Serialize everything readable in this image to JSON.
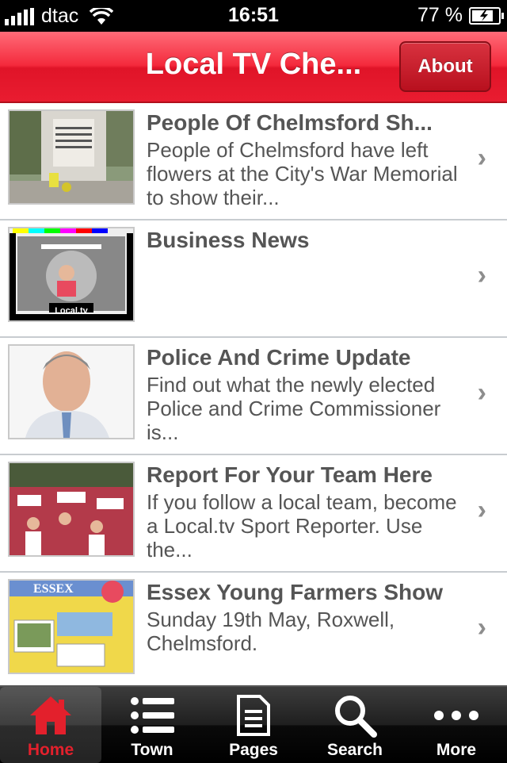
{
  "status": {
    "carrier": "dtac",
    "time": "16:51",
    "battery": "77 %"
  },
  "nav": {
    "title": "Local TV Che...",
    "about_label": "About"
  },
  "items": [
    {
      "title": "People Of Chelmsford Sh...",
      "desc": "People of Chelmsford have left flowers at the City's War Memorial to show their..."
    },
    {
      "title": "Business News",
      "desc": "",
      "thumb_label": "Local.tv"
    },
    {
      "title": "Police And Crime Update",
      "desc": "Find out what the newly elected Police and Crime Commissioner is..."
    },
    {
      "title": "Report For Your Team Here",
      "desc": "If you follow a local team, become a Local.tv Sport Reporter.  Use the..."
    },
    {
      "title": "Essex Young Farmers Show",
      "desc": "Sunday 19th May, Roxwell, Chelmsford.",
      "thumb_label": "ESSEX"
    }
  ],
  "tabs": [
    {
      "label": "Home",
      "icon": "house-icon"
    },
    {
      "label": "Town",
      "icon": "list-icon"
    },
    {
      "label": "Pages",
      "icon": "document-icon"
    },
    {
      "label": "Search",
      "icon": "search-icon"
    },
    {
      "label": "More",
      "icon": "more-icon"
    }
  ],
  "colors": {
    "accent": "#e91c30",
    "active_tab": "#e3202c",
    "text": "#555555"
  }
}
